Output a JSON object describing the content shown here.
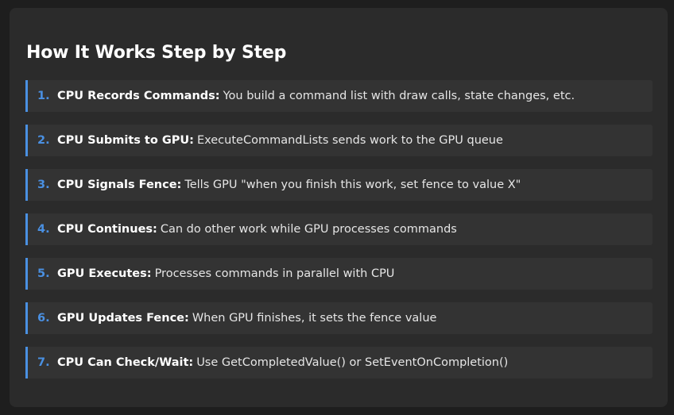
{
  "title": "How It Works Step by Step",
  "steps": [
    {
      "num": "1.",
      "bold": "CPU Records Commands:",
      "text": "You build a command list with draw calls, state changes, etc."
    },
    {
      "num": "2.",
      "bold": "CPU Submits to GPU:",
      "text": "ExecuteCommandLists sends work to the GPU queue"
    },
    {
      "num": "3.",
      "bold": "CPU Signals Fence:",
      "text": "Tells GPU \"when you finish this work, set fence to value X\""
    },
    {
      "num": "4.",
      "bold": "CPU Continues:",
      "text": "Can do other work while GPU processes commands"
    },
    {
      "num": "5.",
      "bold": "GPU Executes:",
      "text": "Processes commands in parallel with CPU"
    },
    {
      "num": "6.",
      "bold": "GPU Updates Fence:",
      "text": "When GPU finishes, it sets the fence value"
    },
    {
      "num": "7.",
      "bold": "CPU Can Check/Wait:",
      "text": "Use GetCompletedValue() or SetEventOnCompletion()"
    }
  ],
  "colors": {
    "accent": "#4a90e2",
    "page_background": "#1e1e1e",
    "card_background": "#2b2b2b",
    "step_background": "#333333",
    "heading_text": "#ffffff"
  }
}
